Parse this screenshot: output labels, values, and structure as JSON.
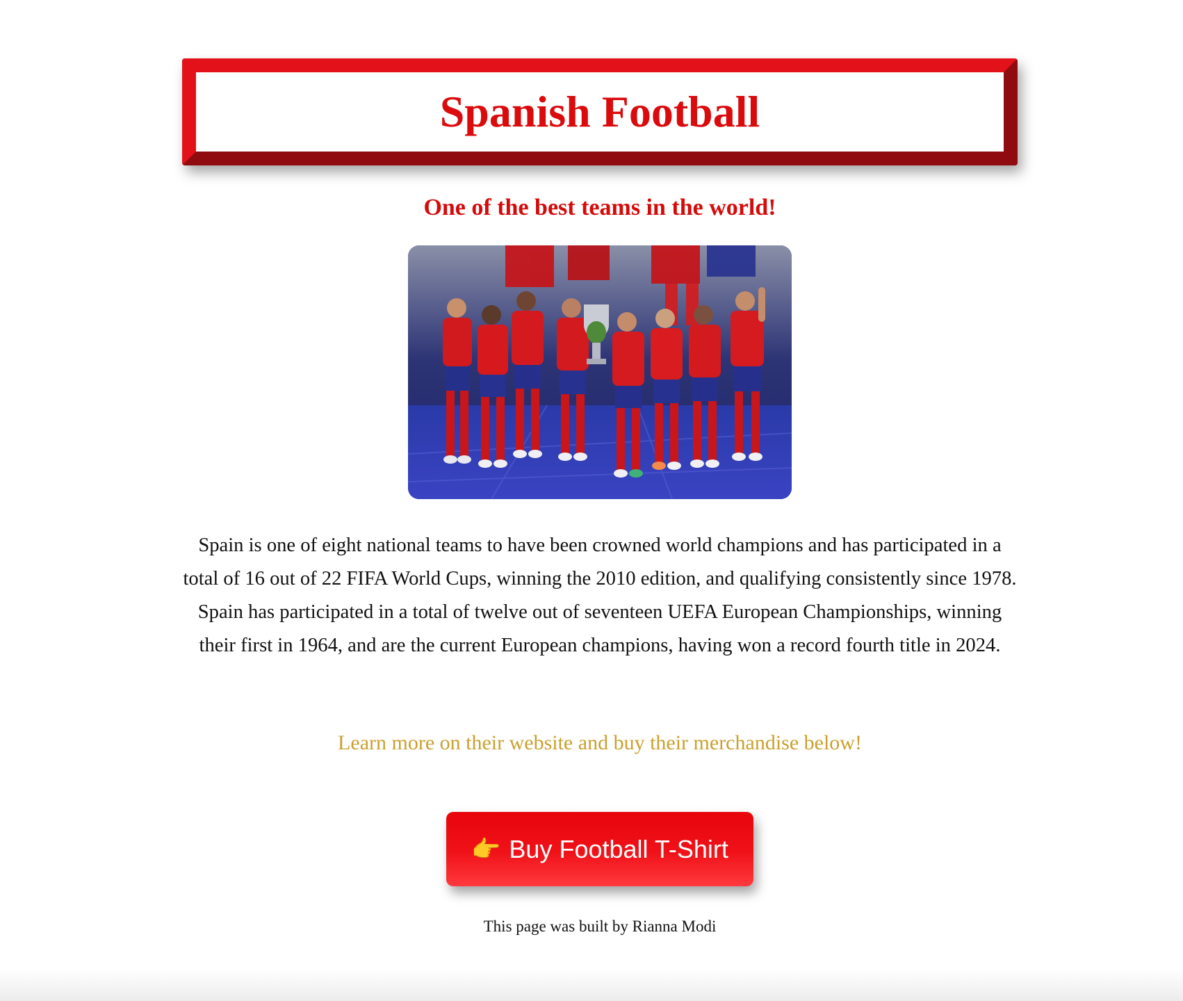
{
  "header": {
    "title": "Spanish Football",
    "accent_color": "#e3121a"
  },
  "tagline": "One of the best teams in the world!",
  "hero_image": {
    "subject": "team-celebration-photo"
  },
  "description": "Spain is one of eight national teams to have been crowned world champions and has participated in a total of 16 out of 22 FIFA World Cups, winning the 2010 edition, and qualifying consistently since 1978. Spain has participated in a total of twelve out of seventeen UEFA European Championships, winning their first in 1964, and are the current European champions, having won a record fourth title in 2024.",
  "cta": {
    "text": "Learn more on their website and buy their merchandise below!",
    "color": "#caa02e"
  },
  "buy_button": {
    "icon": "pointing-hand-icon",
    "icon_glyph": "👉",
    "label": "Buy Football T-Shirt",
    "color": "#f01219"
  },
  "footer": {
    "text": "This page was built by Rianna Modi"
  }
}
